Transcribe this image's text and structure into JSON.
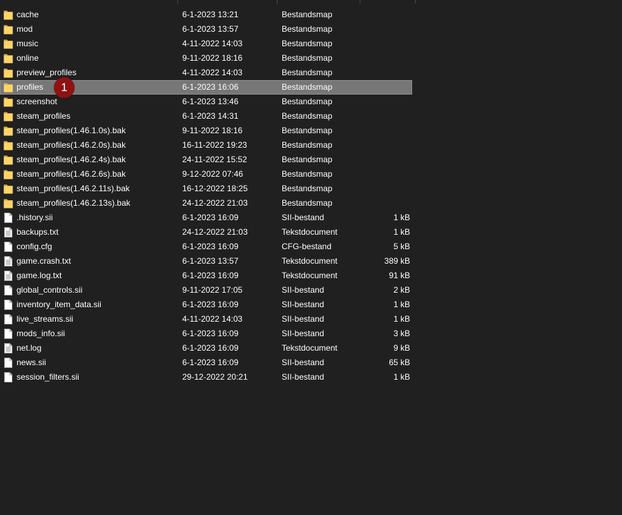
{
  "colors": {
    "background": "#202020",
    "text": "#ffffff",
    "selected_row": "#777777",
    "folder_icon": "#f4c95d",
    "badge": "#8e1212"
  },
  "selected_index": 5,
  "annotation": {
    "label": "1"
  },
  "files": [
    {
      "name": "cache",
      "date": "6-1-2023 13:21",
      "type": "Bestandsmap",
      "size": "",
      "icon": "folder-icon"
    },
    {
      "name": "mod",
      "date": "6-1-2023 13:57",
      "type": "Bestandsmap",
      "size": "",
      "icon": "folder-icon"
    },
    {
      "name": "music",
      "date": "4-11-2022 14:03",
      "type": "Bestandsmap",
      "size": "",
      "icon": "folder-icon"
    },
    {
      "name": "online",
      "date": "9-11-2022 18:16",
      "type": "Bestandsmap",
      "size": "",
      "icon": "folder-icon"
    },
    {
      "name": "preview_profiles",
      "date": "4-11-2022 14:03",
      "type": "Bestandsmap",
      "size": "",
      "icon": "folder-icon"
    },
    {
      "name": "profiles",
      "date": "6-1-2023 16:06",
      "type": "Bestandsmap",
      "size": "",
      "icon": "folder-icon"
    },
    {
      "name": "screenshot",
      "date": "6-1-2023 13:46",
      "type": "Bestandsmap",
      "size": "",
      "icon": "folder-icon"
    },
    {
      "name": "steam_profiles",
      "date": "6-1-2023 14:31",
      "type": "Bestandsmap",
      "size": "",
      "icon": "folder-icon"
    },
    {
      "name": "steam_profiles(1.46.1.0s).bak",
      "date": "9-11-2022 18:16",
      "type": "Bestandsmap",
      "size": "",
      "icon": "folder-icon"
    },
    {
      "name": "steam_profiles(1.46.2.0s).bak",
      "date": "16-11-2022 19:23",
      "type": "Bestandsmap",
      "size": "",
      "icon": "folder-icon"
    },
    {
      "name": "steam_profiles(1.46.2.4s).bak",
      "date": "24-11-2022 15:52",
      "type": "Bestandsmap",
      "size": "",
      "icon": "folder-icon"
    },
    {
      "name": "steam_profiles(1.46.2.6s).bak",
      "date": "9-12-2022 07:46",
      "type": "Bestandsmap",
      "size": "",
      "icon": "folder-icon"
    },
    {
      "name": "steam_profiles(1.46.2.11s).bak",
      "date": "16-12-2022 18:25",
      "type": "Bestandsmap",
      "size": "",
      "icon": "folder-icon"
    },
    {
      "name": "steam_profiles(1.46.2.13s).bak",
      "date": "24-12-2022 21:03",
      "type": "Bestandsmap",
      "size": "",
      "icon": "folder-icon"
    },
    {
      "name": ".history.sii",
      "date": "6-1-2023 16:09",
      "type": "SII-bestand",
      "size": "1 kB",
      "icon": "file-icon"
    },
    {
      "name": "backups.txt",
      "date": "24-12-2022 21:03",
      "type": "Tekstdocument",
      "size": "1 kB",
      "icon": "text-file-icon"
    },
    {
      "name": "config.cfg",
      "date": "6-1-2023 16:09",
      "type": "CFG-bestand",
      "size": "5 kB",
      "icon": "file-icon"
    },
    {
      "name": "game.crash.txt",
      "date": "6-1-2023 13:57",
      "type": "Tekstdocument",
      "size": "389 kB",
      "icon": "text-file-icon"
    },
    {
      "name": "game.log.txt",
      "date": "6-1-2023 16:09",
      "type": "Tekstdocument",
      "size": "91 kB",
      "icon": "text-file-icon"
    },
    {
      "name": "global_controls.sii",
      "date": "9-11-2022 17:05",
      "type": "SII-bestand",
      "size": "2 kB",
      "icon": "file-icon"
    },
    {
      "name": "inventory_item_data.sii",
      "date": "6-1-2023 16:09",
      "type": "SII-bestand",
      "size": "1 kB",
      "icon": "file-icon"
    },
    {
      "name": "live_streams.sii",
      "date": "4-11-2022 14:03",
      "type": "SII-bestand",
      "size": "1 kB",
      "icon": "file-icon"
    },
    {
      "name": "mods_info.sii",
      "date": "6-1-2023 16:09",
      "type": "SII-bestand",
      "size": "3 kB",
      "icon": "file-icon"
    },
    {
      "name": "net.log",
      "date": "6-1-2023 16:09",
      "type": "Tekstdocument",
      "size": "9 kB",
      "icon": "text-file-icon"
    },
    {
      "name": "news.sii",
      "date": "6-1-2023 16:09",
      "type": "SII-bestand",
      "size": "65 kB",
      "icon": "file-icon"
    },
    {
      "name": "session_filters.sii",
      "date": "29-12-2022 20:21",
      "type": "SII-bestand",
      "size": "1 kB",
      "icon": "file-icon"
    }
  ]
}
